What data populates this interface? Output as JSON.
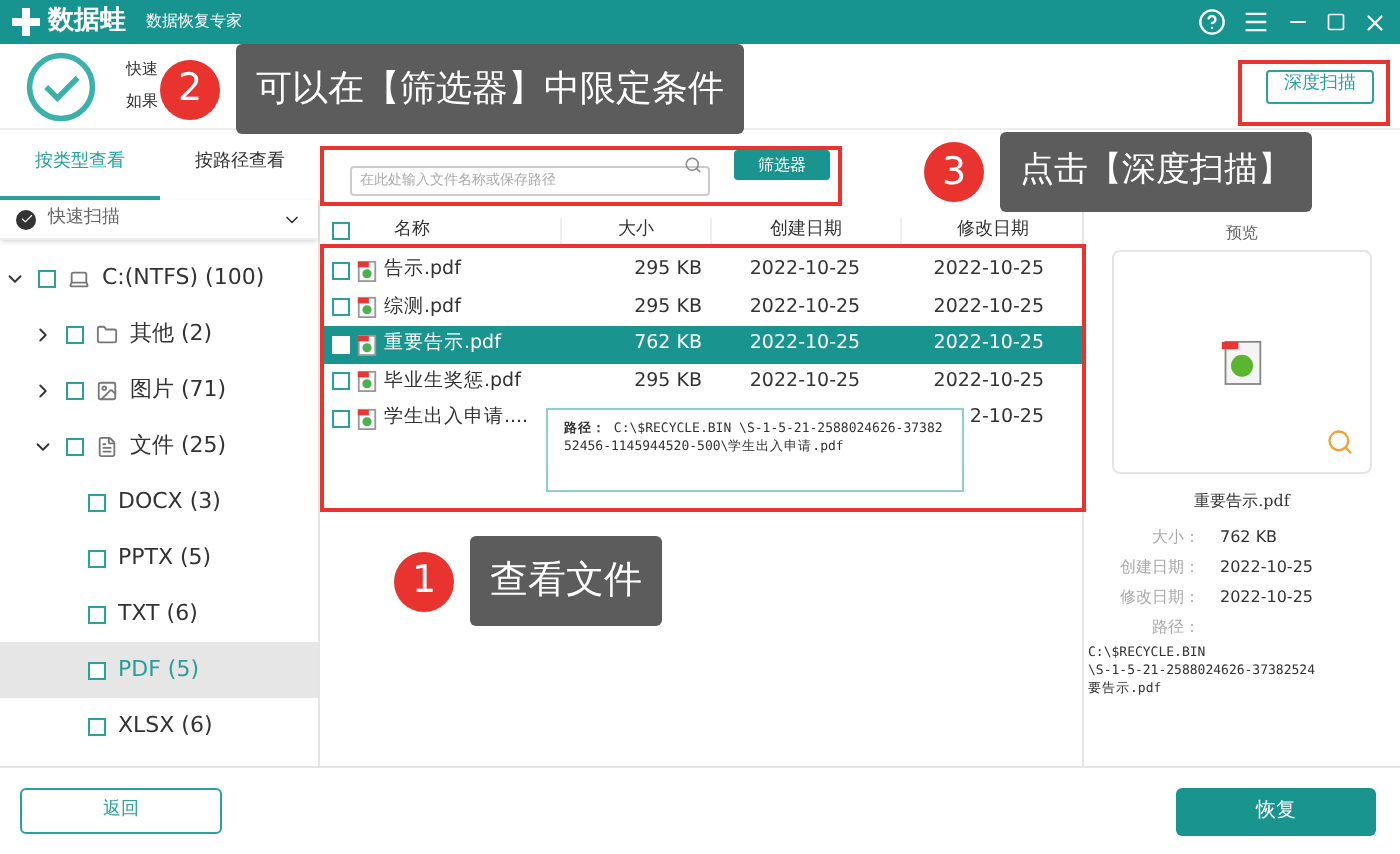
{
  "title_bar": {
    "app_name": "数据蛙",
    "subtitle": "数据恢复专家"
  },
  "header": {
    "status_line": "快速",
    "hint_line": "如果",
    "deep_scan_button": "深度扫描"
  },
  "view_tabs": [
    {
      "label": "按类型查看",
      "selected": true
    },
    {
      "label": "按路径查看",
      "selected": false
    }
  ],
  "search": {
    "placeholder": "在此处输入文件名称或保存路径"
  },
  "filter_button": "筛选器",
  "scan_mode": {
    "label": "快速扫描"
  },
  "tree": [
    {
      "label": "C:(NTFS) (100)",
      "kind": "drive",
      "expanded": true,
      "selected": false,
      "children": [
        {
          "label": "其他 (2)",
          "kind": "folder",
          "expanded": false,
          "selected": false
        },
        {
          "label": "图片 (71)",
          "kind": "image",
          "expanded": false,
          "selected": false
        },
        {
          "label": "文件 (25)",
          "kind": "document",
          "expanded": true,
          "selected": false,
          "children": [
            {
              "label": "DOCX (3)",
              "selected": false
            },
            {
              "label": "PPTX (5)",
              "selected": false
            },
            {
              "label": "TXT (6)",
              "selected": false
            },
            {
              "label": "PDF (5)",
              "selected": true
            },
            {
              "label": "XLSX (6)",
              "selected": false
            }
          ]
        }
      ]
    }
  ],
  "table": {
    "columns": [
      "名称",
      "大小",
      "创建日期",
      "修改日期"
    ],
    "all_checked": false,
    "rows": [
      {
        "name": "告示.pdf",
        "size": "295 KB",
        "created": "2022-10-25",
        "modified": "2022-10-25",
        "selected": false
      },
      {
        "name": "综测.pdf",
        "size": "295 KB",
        "created": "2022-10-25",
        "modified": "2022-10-25",
        "selected": false
      },
      {
        "name": "重要告示.pdf",
        "size": "762 KB",
        "created": "2022-10-25",
        "modified": "2022-10-25",
        "selected": true
      },
      {
        "name": "毕业生奖惩.pdf",
        "size": "295 KB",
        "created": "2022-10-25",
        "modified": "2022-10-25",
        "selected": false
      },
      {
        "name": "学生出入申请....",
        "modified": "2-10-25",
        "selected": false
      }
    ]
  },
  "tooltip": {
    "label": "路径：",
    "text": "C:\\$RECYCLE.BIN \\S-1-5-21-2588024626-3738252456-1145944520-500\\学生出入申请.pdf"
  },
  "preview": {
    "title": "预览",
    "file_name": "重要告示.pdf",
    "details": [
      {
        "label": "大小：",
        "value": "762 KB"
      },
      {
        "label": "创建日期：",
        "value": "2022-10-25"
      },
      {
        "label": "修改日期：",
        "value": "2022-10-25"
      }
    ],
    "path_label": "路径：",
    "path_lines": [
      "C:\\$RECYCLE.BIN",
      "\\S-1-5-21-2588024626-37382524",
      "要告示.pdf"
    ]
  },
  "footer": {
    "back_button": "返回",
    "recover_button": "恢复"
  },
  "annotations": [
    {
      "number": "1",
      "text": "查看文件"
    },
    {
      "number": "2",
      "text": "可以在【筛选器】中限定条件"
    },
    {
      "number": "3",
      "text": "点击【深度扫描】"
    }
  ]
}
